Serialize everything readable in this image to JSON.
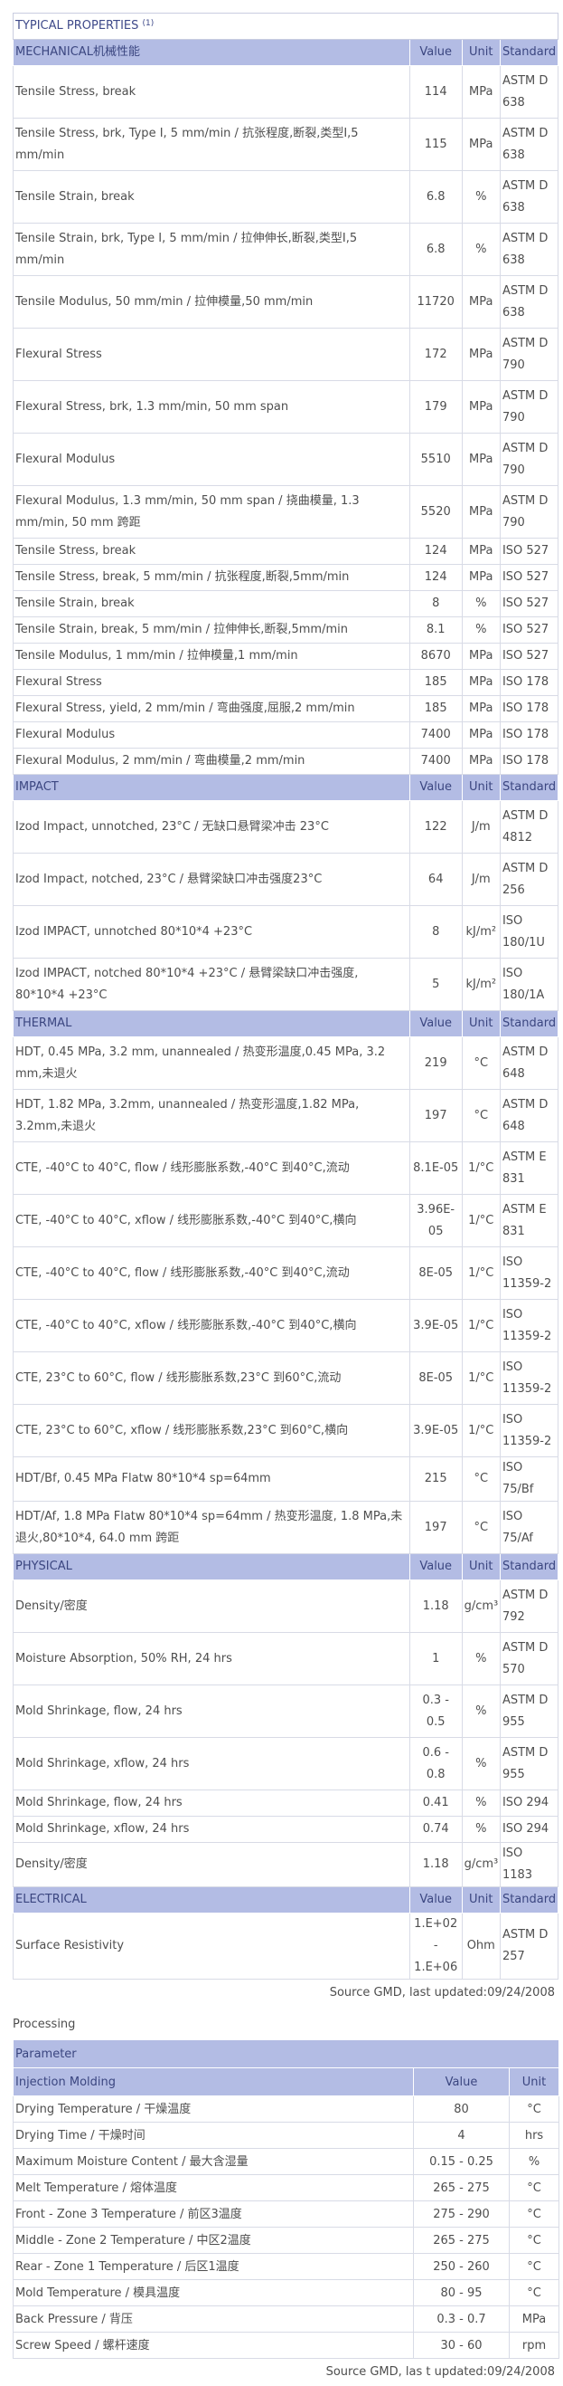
{
  "properties": {
    "title": "TYPICAL PROPERTIES",
    "title_sup": "(1)",
    "sections": [
      {
        "name": "MECHANICAL机械性能",
        "header": {
          "value": "Value",
          "unit": "Unit",
          "standard": "Standard"
        },
        "rows": [
          {
            "label": "Tensile Stress, break",
            "value": "114",
            "unit": "MPa",
            "standard": "ASTM D 638",
            "h": 58
          },
          {
            "label": "Tensile Stress, brk, Type I, 5 mm/min / 抗张程度,断裂,类型I,5 mm/min",
            "value": "115",
            "unit": "MPa",
            "standard": "ASTM D 638",
            "h": 58
          },
          {
            "label": "Tensile Strain, break",
            "value": "6.8",
            "unit": "%",
            "standard": "ASTM D 638",
            "h": 58
          },
          {
            "label": "Tensile Strain, brk, Type I, 5 mm/min / 拉伸伸长,断裂,类型I,5 mm/min",
            "value": "6.8",
            "unit": "%",
            "standard": "ASTM D 638",
            "h": 58
          },
          {
            "label": "Tensile Modulus, 50 mm/min / 拉伸模量,50 mm/min",
            "value": "11720",
            "unit": "MPa",
            "standard": "ASTM D 638",
            "h": 58
          },
          {
            "label": "Flexural Stress",
            "value": "172",
            "unit": "MPa",
            "standard": "ASTM D 790",
            "h": 58
          },
          {
            "label": "Flexural Stress, brk, 1.3 mm/min, 50 mm span",
            "value": "179",
            "unit": "MPa",
            "standard": "ASTM D 790",
            "h": 58
          },
          {
            "label": "Flexural Modulus",
            "value": "5510",
            "unit": "MPa",
            "standard": "ASTM D 790",
            "h": 58
          },
          {
            "label": "Flexural Modulus, 1.3 mm/min, 50 mm span / 挠曲模量, 1.3 mm/min, 50 mm 跨距",
            "value": "5520",
            "unit": "MPa",
            "standard": "ASTM D 790",
            "h": 58
          },
          {
            "label": "Tensile Stress, break",
            "value": "124",
            "unit": "MPa",
            "standard": "ISO 527",
            "h": 29
          },
          {
            "label": "Tensile Stress, break, 5 mm/min / 抗张程度,断裂,5mm/min",
            "value": "124",
            "unit": "MPa",
            "standard": "ISO 527",
            "h": 29
          },
          {
            "label": "Tensile Strain, break",
            "value": "8",
            "unit": "%",
            "standard": "ISO 527",
            "h": 29
          },
          {
            "label": "Tensile Strain, break, 5 mm/min / 拉伸伸长,断裂,5mm/min",
            "value": "8.1",
            "unit": "%",
            "standard": "ISO 527",
            "h": 29
          },
          {
            "label": "Tensile Modulus, 1 mm/min / 拉伸模量,1 mm/min",
            "value": "8670",
            "unit": "MPa",
            "standard": "ISO 527",
            "h": 29
          },
          {
            "label": "Flexural Stress",
            "value": "185",
            "unit": "MPa",
            "standard": "ISO 178",
            "h": 29
          },
          {
            "label": "Flexural Stress, yield, 2 mm/min / 弯曲强度,屈服,2 mm/min",
            "value": "185",
            "unit": "MPa",
            "standard": "ISO 178",
            "h": 29
          },
          {
            "label": "Flexural Modulus",
            "value": "7400",
            "unit": "MPa",
            "standard": "ISO 178",
            "h": 29
          },
          {
            "label": "Flexural Modulus, 2 mm/min / 弯曲模量,2 mm/min",
            "value": "7400",
            "unit": "MPa",
            "standard": "ISO 178",
            "h": 29
          }
        ]
      },
      {
        "name": "IMPACT",
        "header": {
          "value": "Value",
          "unit": "Unit",
          "standard": "Standard"
        },
        "rows": [
          {
            "label": "Izod Impact, unnotched, 23°C / 无缺口悬臂梁冲击 23°C",
            "value": "122",
            "unit": "J/m",
            "standard": "ASTM D 4812",
            "h": 58
          },
          {
            "label": "Izod Impact, notched, 23°C / 悬臂梁缺口冲击强度23°C",
            "value": "64",
            "unit": "J/m",
            "standard": "ASTM D 256",
            "h": 58
          },
          {
            "label": "Izod IMPACT, unnotched 80*10*4 +23°C",
            "value": "8",
            "unit": "kJ/m²",
            "standard": "ISO 180/1U",
            "h": 58
          },
          {
            "label": "Izod IMPACT, notched 80*10*4 +23°C / 悬臂梁缺口冲击强度, 80*10*4 +23°C",
            "value": "5",
            "unit": "kJ/m²",
            "standard": "ISO 180/1A",
            "h": 58
          }
        ]
      },
      {
        "name": "THERMAL",
        "header": {
          "value": "Value",
          "unit": "Unit",
          "standard": "Standard"
        },
        "rows": [
          {
            "label": "HDT, 0.45 MPa, 3.2 mm, unannealed / 热变形温度,0.45 MPa, 3.2 mm,未退火",
            "value": "219",
            "unit": "°C",
            "standard": "ASTM D 648",
            "h": 58
          },
          {
            "label": "HDT, 1.82 MPa, 3.2mm, unannealed / 热变形温度,1.82 MPa, 3.2mm,未退火",
            "value": "197",
            "unit": "°C",
            "standard": "ASTM D 648",
            "h": 58
          },
          {
            "label": "CTE, -40°C to 40°C, flow / 线形膨胀系数,-40°C 到40°C,流动",
            "value": "8.1E-05",
            "unit": "1/°C",
            "standard": "ASTM E 831",
            "h": 58
          },
          {
            "label": "CTE, -40°C to 40°C, xflow / 线形膨胀系数,-40°C 到40°C,横向",
            "value": "3.96E-05",
            "unit": "1/°C",
            "standard": "ASTM E 831",
            "h": 58
          },
          {
            "label": "CTE, -40°C to 40°C, flow / 线形膨胀系数,-40°C 到40°C,流动",
            "value": "8E-05",
            "unit": "1/°C",
            "standard": "ISO 11359-2",
            "h": 58
          },
          {
            "label": "CTE, -40°C to 40°C, xflow / 线形膨胀系数,-40°C 到40°C,横向",
            "value": "3.9E-05",
            "unit": "1/°C",
            "standard": "ISO 11359-2",
            "h": 58
          },
          {
            "label": "CTE, 23°C to 60°C, flow / 线形膨胀系数,23°C 到60°C,流动",
            "value": "8E-05",
            "unit": "1/°C",
            "standard": "ISO 11359-2",
            "h": 58
          },
          {
            "label": "CTE, 23°C to 60°C, xflow / 线形膨胀系数,23°C 到60°C,横向",
            "value": "3.9E-05",
            "unit": "1/°C",
            "standard": "ISO 11359-2",
            "h": 58
          },
          {
            "label": "HDT/Bf, 0.45 MPa Flatw 80*10*4 sp=64mm",
            "value": "215",
            "unit": "°C",
            "standard": "ISO 75/Bf",
            "h": 29
          },
          {
            "label": "HDT/Af, 1.8 MPa Flatw 80*10*4 sp=64mm / 热变形温度, 1.8 MPa,未退火,80*10*4, 64.0 mm 跨距",
            "value": "197",
            "unit": "°C",
            "standard": "ISO 75/Af",
            "h": 58
          }
        ]
      },
      {
        "name": "PHYSICAL",
        "header": {
          "value": "Value",
          "unit": "Unit",
          "standard": "Standard"
        },
        "rows": [
          {
            "label": "Density/密度",
            "value": "1.18",
            "unit": "g/cm³",
            "standard": "ASTM D 792",
            "h": 58
          },
          {
            "label": "Moisture Absorption, 50% RH, 24 hrs",
            "value": "1",
            "unit": "%",
            "standard": "ASTM D 570",
            "h": 58
          },
          {
            "label": "Mold Shrinkage, flow, 24 hrs",
            "value": "0.3 - 0.5",
            "unit": "%",
            "standard": "ASTM D 955",
            "h": 58
          },
          {
            "label": "Mold Shrinkage, xflow, 24 hrs",
            "value": "0.6 - 0.8",
            "unit": "%",
            "standard": "ASTM D 955",
            "h": 58
          },
          {
            "label": "Mold Shrinkage, flow, 24 hrs",
            "value": "0.41",
            "unit": "%",
            "standard": "ISO 294",
            "h": 29
          },
          {
            "label": "Mold Shrinkage, xflow, 24 hrs",
            "value": "0.74",
            "unit": "%",
            "standard": "ISO 294",
            "h": 29
          },
          {
            "label": "Density/密度",
            "value": "1.18",
            "unit": "g/cm³",
            "standard": "ISO 1183",
            "h": 29
          }
        ]
      },
      {
        "name": "ELECTRICAL",
        "header": {
          "value": "Value",
          "unit": "Unit",
          "standard": "Standard"
        },
        "rows": [
          {
            "label": "Surface Resistivity",
            "value": "1.E+02 - 1.E+06",
            "unit": "Ohm",
            "standard": "ASTM D 257",
            "h": 58
          }
        ]
      }
    ],
    "source": "Source GMD, last updated:09/24/2008"
  },
  "processing": {
    "title": "Processing",
    "header": "Parameter",
    "section": {
      "name": "Injection Molding",
      "value": "Value",
      "unit": "Unit"
    },
    "rows": [
      {
        "label": "Drying Temperature / 干燥温度",
        "value": "80",
        "unit": "°C"
      },
      {
        "label": "Drying Time / 干燥时间",
        "value": "4",
        "unit": "hrs"
      },
      {
        "label": "Maximum Moisture Content / 最大含湿量",
        "value": "0.15 - 0.25",
        "unit": "%"
      },
      {
        "label": "Melt Temperature / 熔体温度",
        "value": "265 - 275",
        "unit": "°C"
      },
      {
        "label": "Front - Zone 3 Temperature / 前区3温度",
        "value": "275 - 290",
        "unit": "°C"
      },
      {
        "label": "Middle - Zone 2 Temperature / 中区2温度",
        "value": "265 - 275",
        "unit": "°C"
      },
      {
        "label": "Rear - Zone 1 Temperature / 后区1温度",
        "value": "250 - 260",
        "unit": "°C"
      },
      {
        "label": "Mold Temperature / 模具温度",
        "value": "80 - 95",
        "unit": "°C"
      },
      {
        "label": "Back Pressure / 背压",
        "value": "0.3 - 0.7",
        "unit": "MPa"
      },
      {
        "label": "Screw Speed / 螺杆速度",
        "value": "30 - 60",
        "unit": "rpm"
      }
    ],
    "source": "Source GMD, las t updated:09/24/2008"
  }
}
